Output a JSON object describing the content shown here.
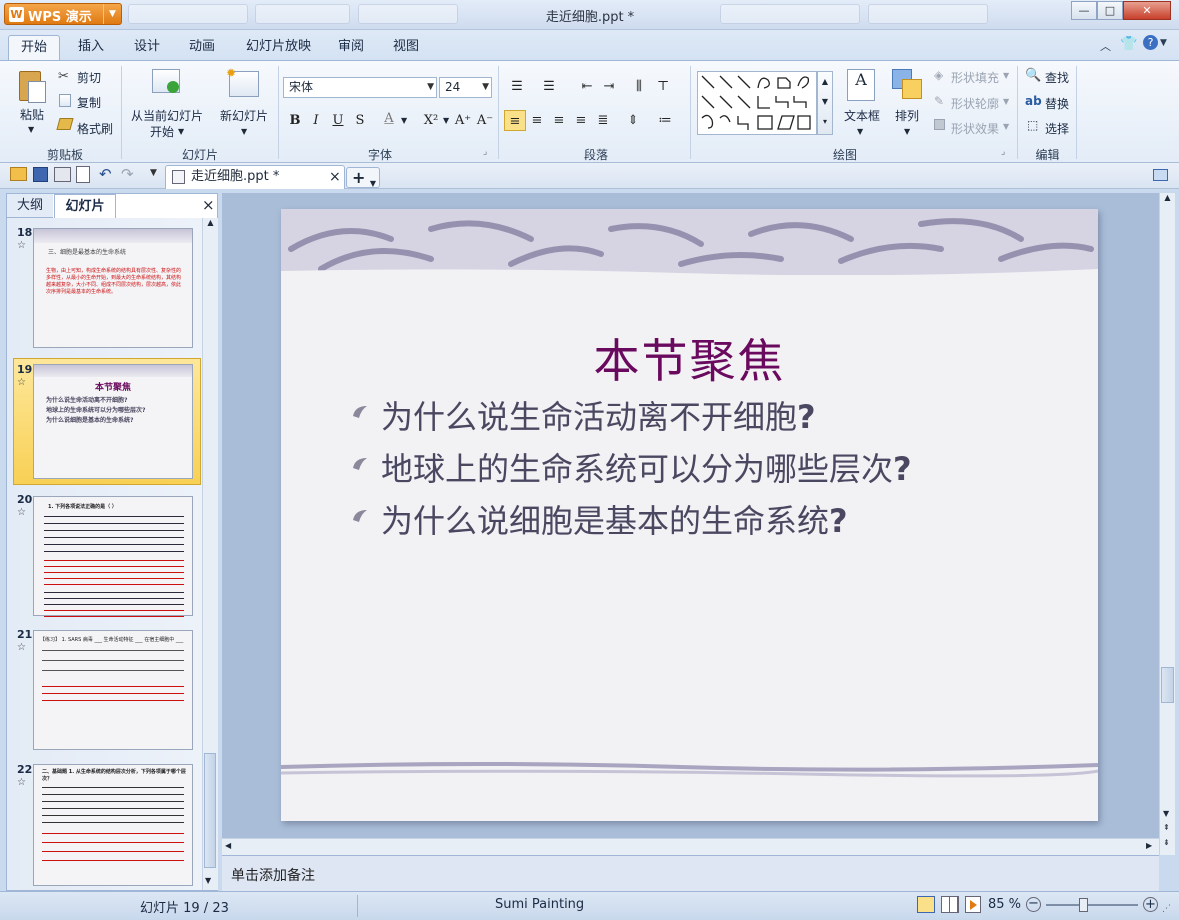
{
  "app": {
    "logo_text": "WPS 演示",
    "logo_badge": "W",
    "window_title": "走近细胞.ppt *"
  },
  "window_controls": {
    "minimize": "—",
    "maximize": "□",
    "close": "✕"
  },
  "menu_tabs": [
    "开始",
    "插入",
    "设计",
    "动画",
    "幻灯片放映",
    "审阅",
    "视图"
  ],
  "ribbon": {
    "clipboard": {
      "paste": "粘贴",
      "cut": "剪切",
      "copy": "复制",
      "format_painter": "格式刷",
      "group": "剪贴板"
    },
    "slides": {
      "from_current_l1": "从当前幻灯片",
      "from_current_l2": "开始",
      "new_slide": "新幻灯片",
      "group": "幻灯片"
    },
    "font": {
      "name": "宋体",
      "size": "24",
      "group": "字体",
      "bold": "B",
      "italic": "I",
      "underline": "U",
      "shadow": "S",
      "color": "A",
      "superscript": "X²",
      "grow": "A⁺",
      "shrink": "A⁻"
    },
    "paragraph": {
      "group": "段落"
    },
    "drawing": {
      "textbox": "文本框",
      "arrange": "排列",
      "shape_fill": "形状填充",
      "shape_outline": "形状轮廓",
      "shape_effects": "形状效果",
      "group": "绘图"
    },
    "editing": {
      "find": "查找",
      "replace": "替换",
      "select": "选择",
      "group": "编辑"
    }
  },
  "doc_tab": {
    "label": "走近细胞.ppt *",
    "close": "×",
    "new": "+"
  },
  "panel": {
    "tabs": [
      "大纲",
      "幻灯片"
    ],
    "close": "×"
  },
  "thumbnails": [
    {
      "num": "18",
      "star": "☆",
      "title": "三、细胞是最基本的生命系统",
      "body": "生物，由上可知，构成生命系统的结构具有层次性、复杂性的多样性，从最小的生命开始，到最大的生命系统结构，其结构越来越复杂，大小不同、组成不同层次结构，层次越高，依此次序排列是最基本的生命系统。"
    },
    {
      "num": "19",
      "star": "☆",
      "title": "本节聚焦",
      "lines": [
        "为什么说生命活动离不开细胞?",
        "地球上的生命系统可以分为哪些层次?",
        "为什么说细胞是基本的生命系统?"
      ]
    },
    {
      "num": "20",
      "star": "☆",
      "body": "1. 下列各项说法正确的是（ ）"
    },
    {
      "num": "21",
      "star": "☆",
      "body": "【练习】 1. SARS 病毒 ___ 生命活动特征 ___ 在宿主细胞中 ___"
    },
    {
      "num": "22",
      "star": "☆",
      "body": "二、基础题 1. 从生命系统的结构层次分析，下列各项属于哪个层次？"
    }
  ],
  "slide": {
    "title": "本节聚焦",
    "bullets": [
      {
        "text": "为什么说生命活动离不开细胞",
        "q": "?"
      },
      {
        "text": "地球上的生命系统可以分为哪些层次",
        "q": "?"
      },
      {
        "text": "为什么说细胞是基本的生命系统",
        "q": "?"
      }
    ]
  },
  "notes_placeholder": "单击添加备注",
  "status": {
    "slide_counter": "幻灯片 19 / 23",
    "theme": "Sumi Painting",
    "zoom": "85 %"
  },
  "colors": {
    "title": "#6a0a5e",
    "body_text": "#4a4860",
    "thumb_red": "#cc1010",
    "selected_thumb": "#f8d055"
  }
}
